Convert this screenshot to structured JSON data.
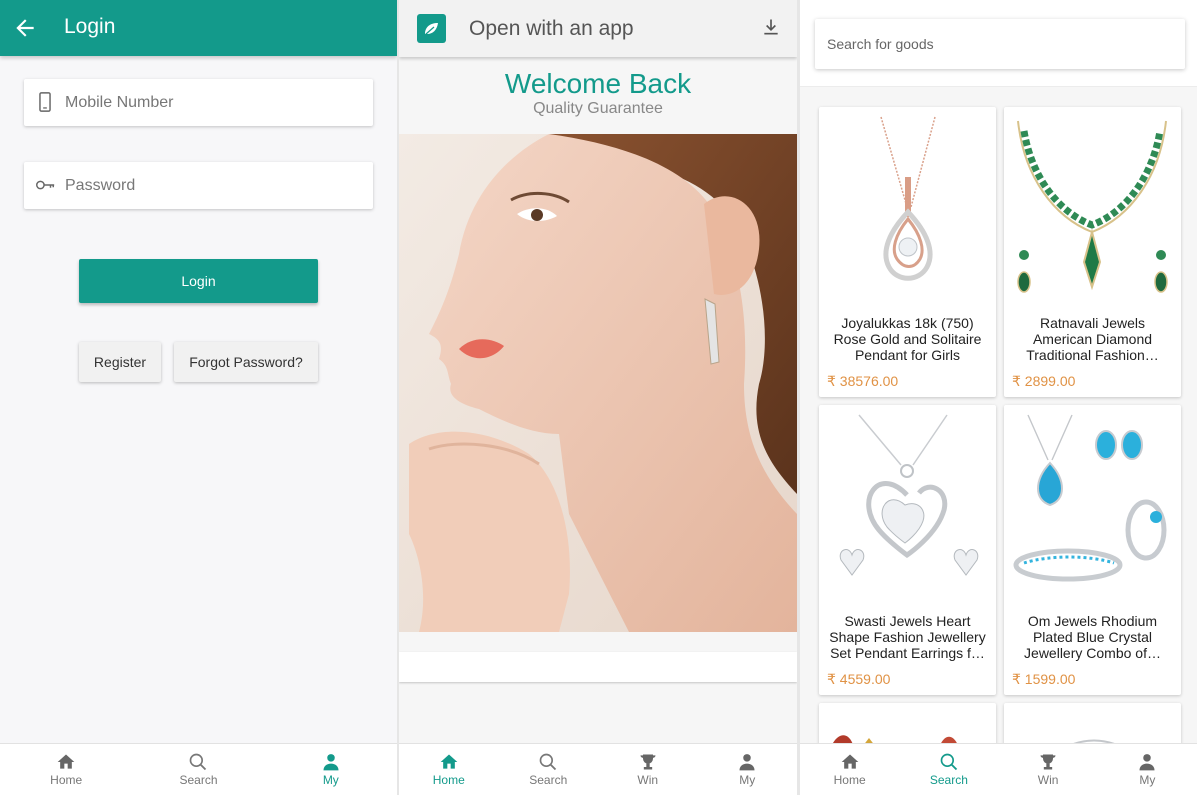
{
  "login_screen": {
    "title": "Login",
    "mobile_placeholder": "Mobile Number",
    "password_placeholder": "Password",
    "login_button": "Login",
    "register_button": "Register",
    "forgot_button": "Forgot Password?",
    "nav": [
      {
        "label": "Home",
        "icon": "home-icon"
      },
      {
        "label": "Search",
        "icon": "search-icon"
      },
      {
        "label": "My",
        "icon": "person-icon",
        "active": true
      }
    ]
  },
  "welcome_screen": {
    "app_banner_text": "Open with an app",
    "title": "Welcome Back",
    "subtitle": "Quality Guarantee",
    "nav": [
      {
        "label": "Home",
        "icon": "home-icon",
        "active": true
      },
      {
        "label": "Search",
        "icon": "search-icon"
      },
      {
        "label": "Win",
        "icon": "trophy-icon"
      },
      {
        "label": "My",
        "icon": "person-icon"
      }
    ]
  },
  "products_screen": {
    "search_placeholder": "Search for goods",
    "products": [
      {
        "name": "Joyalukkas 18k (750) Rose Gold and Solitaire Pendant for Girls",
        "price": "₹ 38576.00"
      },
      {
        "name": "Ratnavali Jewels American Diamond Traditional Fashion…",
        "price": "₹ 2899.00"
      },
      {
        "name": "Swasti Jewels Heart Shape Fashion Jewellery Set Pendant Earrings f…",
        "price": "₹ 4559.00"
      },
      {
        "name": "Om Jewels Rhodium Plated Blue Crystal Jewellery Combo of…",
        "price": "₹ 1599.00"
      }
    ],
    "nav": [
      {
        "label": "Home",
        "icon": "home-icon"
      },
      {
        "label": "Search",
        "icon": "search-icon",
        "active": true
      },
      {
        "label": "Win",
        "icon": "trophy-icon"
      },
      {
        "label": "My",
        "icon": "person-icon"
      }
    ]
  },
  "colors": {
    "accent": "#139a8b",
    "price": "#e09245",
    "background": "#f7f7f9"
  }
}
